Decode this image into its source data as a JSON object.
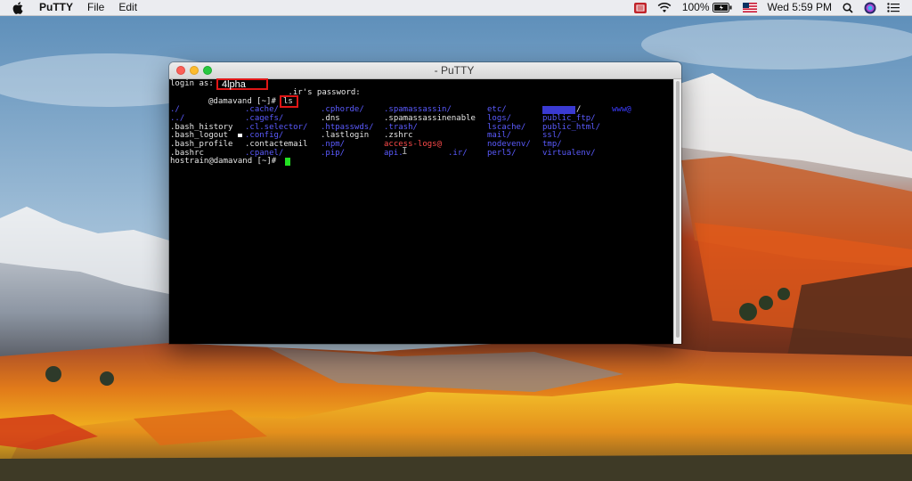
{
  "menubar": {
    "app_name": "PuTTY",
    "menus": [
      "File",
      "Edit"
    ],
    "battery": "100%",
    "clock": "Wed 5:59 PM",
    "icons": [
      "apple-icon",
      "screen-record-icon",
      "wifi-icon",
      "battery-icon",
      "flag-icon",
      "search-icon",
      "siri-icon",
      "list-icon"
    ]
  },
  "window": {
    "title": "- PuTTY"
  },
  "terminal": {
    "login_prefix": "login as:",
    "login_value": "4lpha",
    "password_prompt": "_.ir's password:",
    "prompt_short": "@damavand [~]#",
    "command": "ls",
    "columns": [
      [
        "./",
        "../",
        ".bash_history",
        ".bash_logout",
        ".bash_profile",
        ".bashrc"
      ],
      [
        ".cache/",
        ".cagefs/",
        ".cl.selector/",
        ".config/",
        ".contactemail",
        ".cpanel/"
      ],
      [
        ".cphorde/",
        ".dns",
        ".htpasswds/",
        ".lastlogin",
        ".npm/",
        ".pip/"
      ],
      [
        ".spamassassin/",
        ".spamassassinenable",
        ".trash/",
        ".zshrc",
        "access-logs@",
        "api."
      ],
      [
        "etc/",
        "logs/",
        "lscache/",
        "mail/",
        "nodevenv/",
        "perl5/"
      ],
      [
        "/",
        "public_ftp/",
        "public_html/",
        "ssl/",
        "tmp/",
        "virtualenv/"
      ],
      [
        "www@"
      ]
    ],
    "partial_text": ".ir/",
    "final_prompt": "hostrain@damavand [~]#"
  },
  "colors": {
    "terminal_bg": "#000000",
    "dir_color": "#5b5bff",
    "highlight_box": "#e01616",
    "cursor": "#22e022"
  }
}
